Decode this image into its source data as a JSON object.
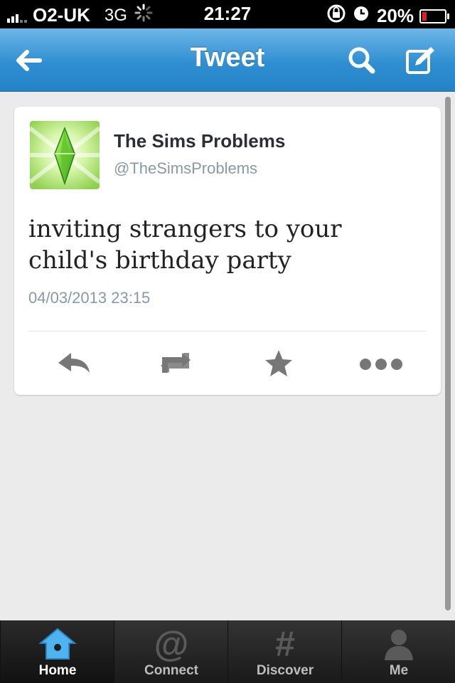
{
  "status_bar": {
    "carrier": "O2-UK",
    "network": "3G",
    "time": "21:27",
    "battery": "20%"
  },
  "nav": {
    "title": "Tweet",
    "back_icon": "back-arrow-icon",
    "search_icon": "search-icon",
    "compose_icon": "compose-icon"
  },
  "tweet": {
    "name": "The Sims Problems",
    "handle": "@TheSimsProblems",
    "text": "inviting strangers to your child's birthday party",
    "timestamp": "04/03/2013 23:15",
    "actions": [
      "reply-icon",
      "retweet-icon",
      "favorite-star-icon",
      "more-icon"
    ]
  },
  "tabs": [
    {
      "label": "Home",
      "icon": "home-icon",
      "active": true
    },
    {
      "label": "Connect",
      "icon": "at-icon",
      "active": false
    },
    {
      "label": "Discover",
      "icon": "hash-icon",
      "active": false
    },
    {
      "label": "Me",
      "icon": "person-icon",
      "active": false
    }
  ],
  "colors": {
    "nav_blue": "#2f8fd1",
    "battery_low": "#e02020",
    "home_icon_blue": "#4fb3f0"
  }
}
